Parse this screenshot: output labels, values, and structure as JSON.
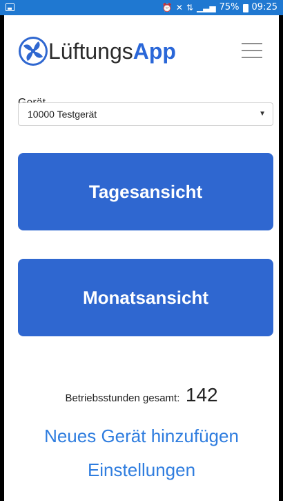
{
  "status_bar": {
    "battery_percent": "75%",
    "time": "09:25",
    "icons": [
      "image-icon",
      "alarm-icon",
      "mute-icon",
      "wifi-icon",
      "signal-icon",
      "battery-icon"
    ]
  },
  "header": {
    "brand_light": "Lüftungs",
    "brand_bold": "App",
    "logo_icon": "fan-icon",
    "menu_icon": "hamburger-menu-icon"
  },
  "device": {
    "label": "Gerät",
    "selected": "10000 Testgerät"
  },
  "buttons": {
    "day_view": "Tagesansicht",
    "month_view": "Monatsansicht"
  },
  "hours": {
    "label": "Betriebsstunden gesamt:",
    "value": "142"
  },
  "links": {
    "add_device": "Neues Gerät hinzufügen",
    "settings": "Einstellungen"
  },
  "colors": {
    "status_bar": "#1f78d1",
    "button": "#2f67d0",
    "link": "#2f7ddf",
    "brand_accent": "#2a67d8"
  }
}
